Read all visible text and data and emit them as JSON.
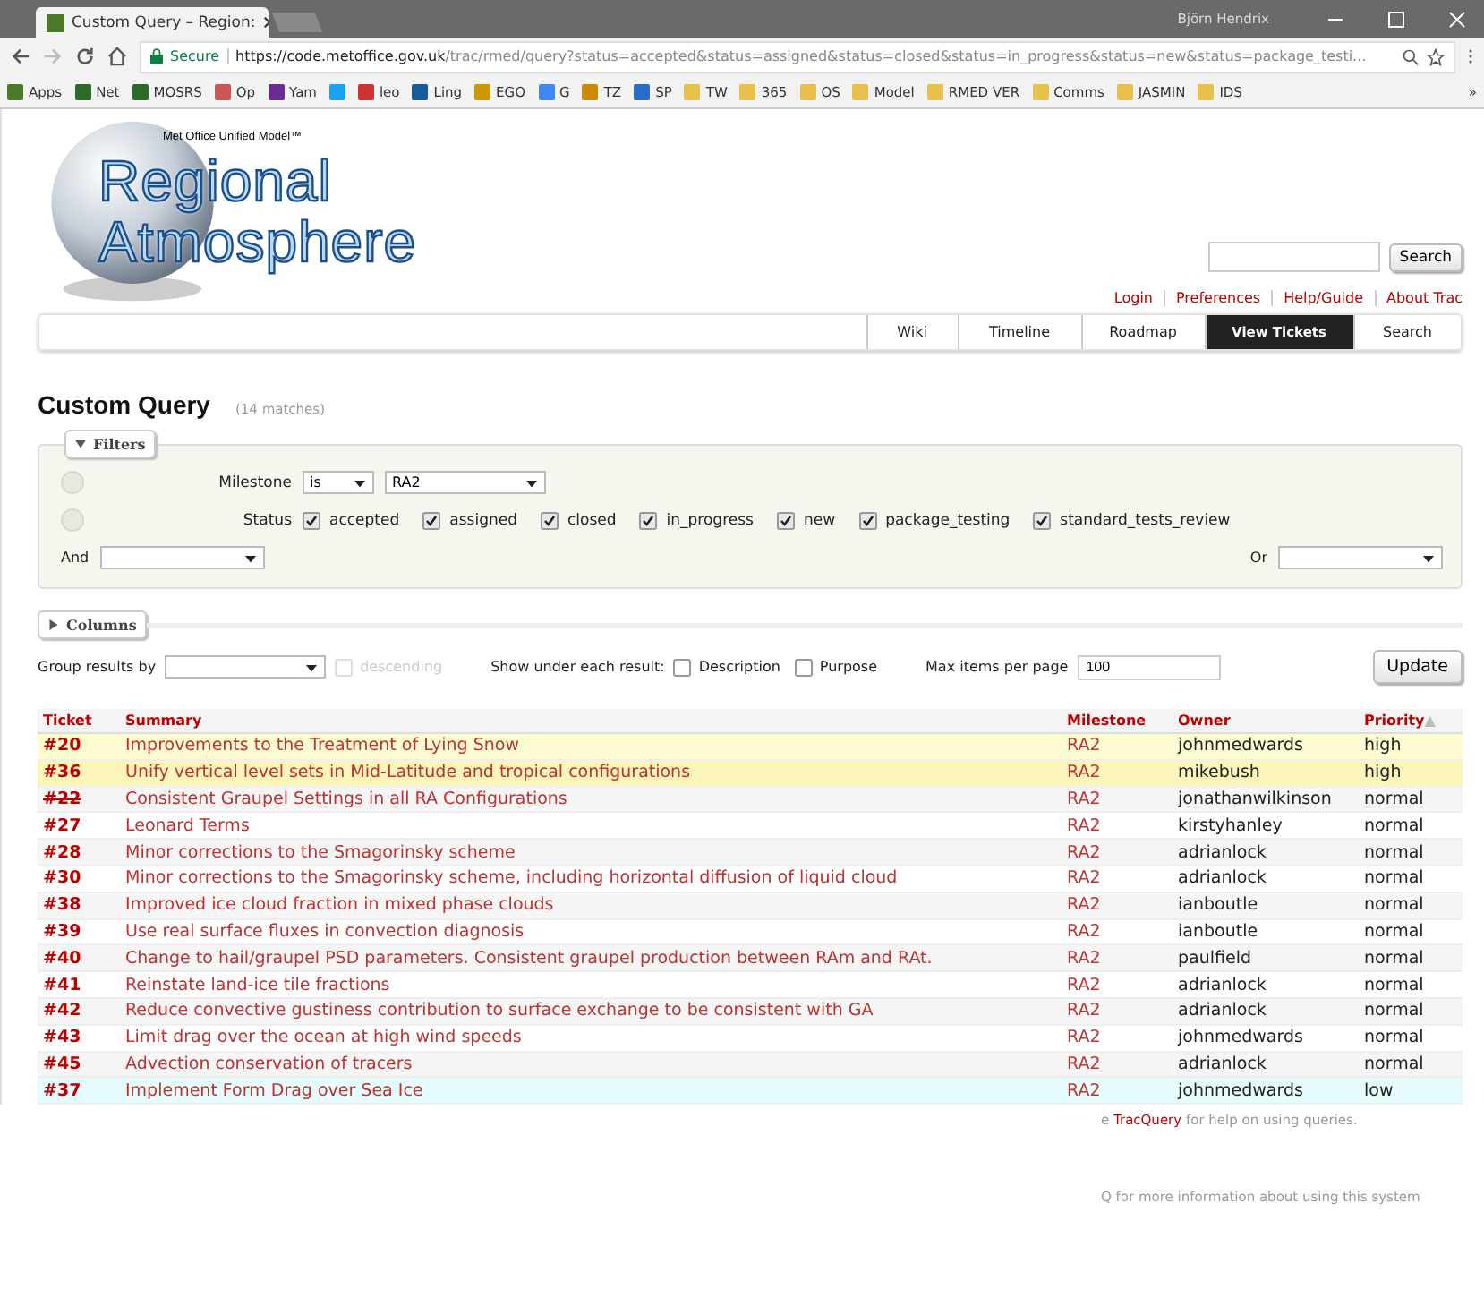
{
  "browser": {
    "tab_title": "Custom Query – Region:",
    "user": "Björn Hendrix",
    "secure_label": "Secure",
    "url_host": "https://code.metoffice.gov.uk",
    "url_path": "/trac/rmed/query?status=accepted&status=assigned&status=closed&status=in_progress&status=new&status=package_testi...",
    "bookmarks": [
      {
        "kind": "site",
        "label": "Apps"
      },
      {
        "kind": "site",
        "label": "Net"
      },
      {
        "kind": "site",
        "label": "MOSRS"
      },
      {
        "kind": "site",
        "label": "Op"
      },
      {
        "kind": "site",
        "label": "Yam"
      },
      {
        "kind": "icon"
      },
      {
        "kind": "site",
        "label": "leo"
      },
      {
        "kind": "site",
        "label": "Ling"
      },
      {
        "kind": "site",
        "label": "EGO"
      },
      {
        "kind": "site",
        "label": "G"
      },
      {
        "kind": "site",
        "label": "TZ"
      },
      {
        "kind": "site",
        "label": "SP"
      },
      {
        "kind": "folder",
        "label": "TW"
      },
      {
        "kind": "folder",
        "label": "365"
      },
      {
        "kind": "folder",
        "label": "OS"
      },
      {
        "kind": "folder",
        "label": "Model"
      },
      {
        "kind": "folder",
        "label": "RMED VER"
      },
      {
        "kind": "folder",
        "label": "Comms"
      },
      {
        "kind": "folder",
        "label": "JASMIN"
      },
      {
        "kind": "folder",
        "label": "IDS"
      }
    ],
    "more": "»"
  },
  "header": {
    "tagline": "Met Office Unified Model™",
    "logo_line1": "Regional",
    "logo_line2": "Atmosphere",
    "search_button": "Search",
    "meta_links": [
      "Login",
      "Preferences",
      "Help/Guide",
      "About Trac"
    ],
    "nav": [
      {
        "label": "Wiki",
        "selected": false
      },
      {
        "label": "Timeline",
        "selected": false
      },
      {
        "label": "Roadmap",
        "selected": false
      },
      {
        "label": "View Tickets",
        "selected": true
      },
      {
        "label": "Search",
        "selected": false
      }
    ]
  },
  "query": {
    "title": "Custom Query",
    "matches": "(14 matches)",
    "filters": {
      "legend": "Filters",
      "milestone_label": "Milestone",
      "milestone_op": "is",
      "milestone_value": "RA2",
      "status_label": "Status",
      "statuses": [
        {
          "label": "accepted",
          "checked": true
        },
        {
          "label": "assigned",
          "checked": true
        },
        {
          "label": "closed",
          "checked": true
        },
        {
          "label": "in_progress",
          "checked": true
        },
        {
          "label": "new",
          "checked": true
        },
        {
          "label": "package_testing",
          "checked": true
        },
        {
          "label": "standard_tests_review",
          "checked": true
        }
      ],
      "and_label": "And",
      "or_label": "Or"
    },
    "columns_legend": "Columns",
    "group_label": "Group results by",
    "descending_label": "descending",
    "descending": {
      "checked": false,
      "disabled": true
    },
    "show_label": "Show under each result:",
    "show_options": [
      {
        "label": "Description",
        "checked": false
      },
      {
        "label": "Purpose",
        "checked": false
      }
    ],
    "max_label": "Max items per page",
    "max_value": "100",
    "update_button": "Update"
  },
  "table": {
    "columns": [
      "Ticket",
      "Summary",
      "Milestone",
      "Owner",
      "Priority"
    ],
    "sort_mark": "▲",
    "rows": [
      {
        "ticket": "#20",
        "summary": "Improvements to the Treatment of Lying Snow",
        "milestone": "RA2",
        "owner": "johnmedwards",
        "priority": "high",
        "color": "#fdfbd0",
        "closed": false
      },
      {
        "ticket": "#36",
        "summary": "Unify vertical level sets in Mid-Latitude and tropical configurations",
        "milestone": "RA2",
        "owner": "mikebush",
        "priority": "high",
        "color": "#fbf5b8",
        "closed": false
      },
      {
        "ticket": "#22",
        "summary": "Consistent Graupel Settings in all RA Configurations",
        "milestone": "RA2",
        "owner": "jonathanwilkinson",
        "priority": "normal",
        "color": "#f5f5f5",
        "closed": true
      },
      {
        "ticket": "#27",
        "summary": "Leonard Terms",
        "milestone": "RA2",
        "owner": "kirstyhanley",
        "priority": "normal",
        "color": "#ffffff",
        "closed": false
      },
      {
        "ticket": "#28",
        "summary": "Minor corrections to the Smagorinsky scheme",
        "milestone": "RA2",
        "owner": "adrianlock",
        "priority": "normal",
        "color": "#f5f5f5",
        "closed": false
      },
      {
        "ticket": "#30",
        "summary": "Minor corrections to the Smagorinsky scheme, including horizontal diffusion of liquid cloud",
        "milestone": "RA2",
        "owner": "adrianlock",
        "priority": "normal",
        "color": "#ffffff",
        "closed": false
      },
      {
        "ticket": "#38",
        "summary": "Improved ice cloud fraction in mixed phase clouds",
        "milestone": "RA2",
        "owner": "ianboutle",
        "priority": "normal",
        "color": "#f5f5f5",
        "closed": false
      },
      {
        "ticket": "#39",
        "summary": "Use real surface fluxes in convection diagnosis",
        "milestone": "RA2",
        "owner": "ianboutle",
        "priority": "normal",
        "color": "#ffffff",
        "closed": false
      },
      {
        "ticket": "#40",
        "summary": "Change to hail/graupel PSD parameters. Consistent graupel production between RAm and RAt.",
        "milestone": "RA2",
        "owner": "paulfield",
        "priority": "normal",
        "color": "#f5f5f5",
        "closed": false
      },
      {
        "ticket": "#41",
        "summary": "Reinstate land-ice tile fractions",
        "milestone": "RA2",
        "owner": "adrianlock",
        "priority": "normal",
        "color": "#ffffff",
        "closed": false
      },
      {
        "ticket": "#42",
        "summary": "Reduce convective gustiness contribution to surface exchange to be consistent with GA",
        "milestone": "RA2",
        "owner": "adrianlock",
        "priority": "normal",
        "color": "#f5f5f5",
        "closed": false
      },
      {
        "ticket": "#43",
        "summary": "Limit drag over the ocean at high wind speeds",
        "milestone": "RA2",
        "owner": "johnmedwards",
        "priority": "normal",
        "color": "#ffffff",
        "closed": false
      },
      {
        "ticket": "#45",
        "summary": "Advection conservation of tracers",
        "milestone": "RA2",
        "owner": "adrianlock",
        "priority": "normal",
        "color": "#f5f5f5",
        "closed": false
      },
      {
        "ticket": "#37",
        "summary": "Implement Form Drag over Sea Ice",
        "milestone": "RA2",
        "owner": "johnmedwards",
        "priority": "low",
        "color": "#e6fcfc",
        "closed": false
      }
    ]
  },
  "footer": {
    "help_pre": "e ",
    "help_link": "TracQuery",
    "help_post": " for help on using queries.",
    "more": "Q for more information about using this system"
  }
}
